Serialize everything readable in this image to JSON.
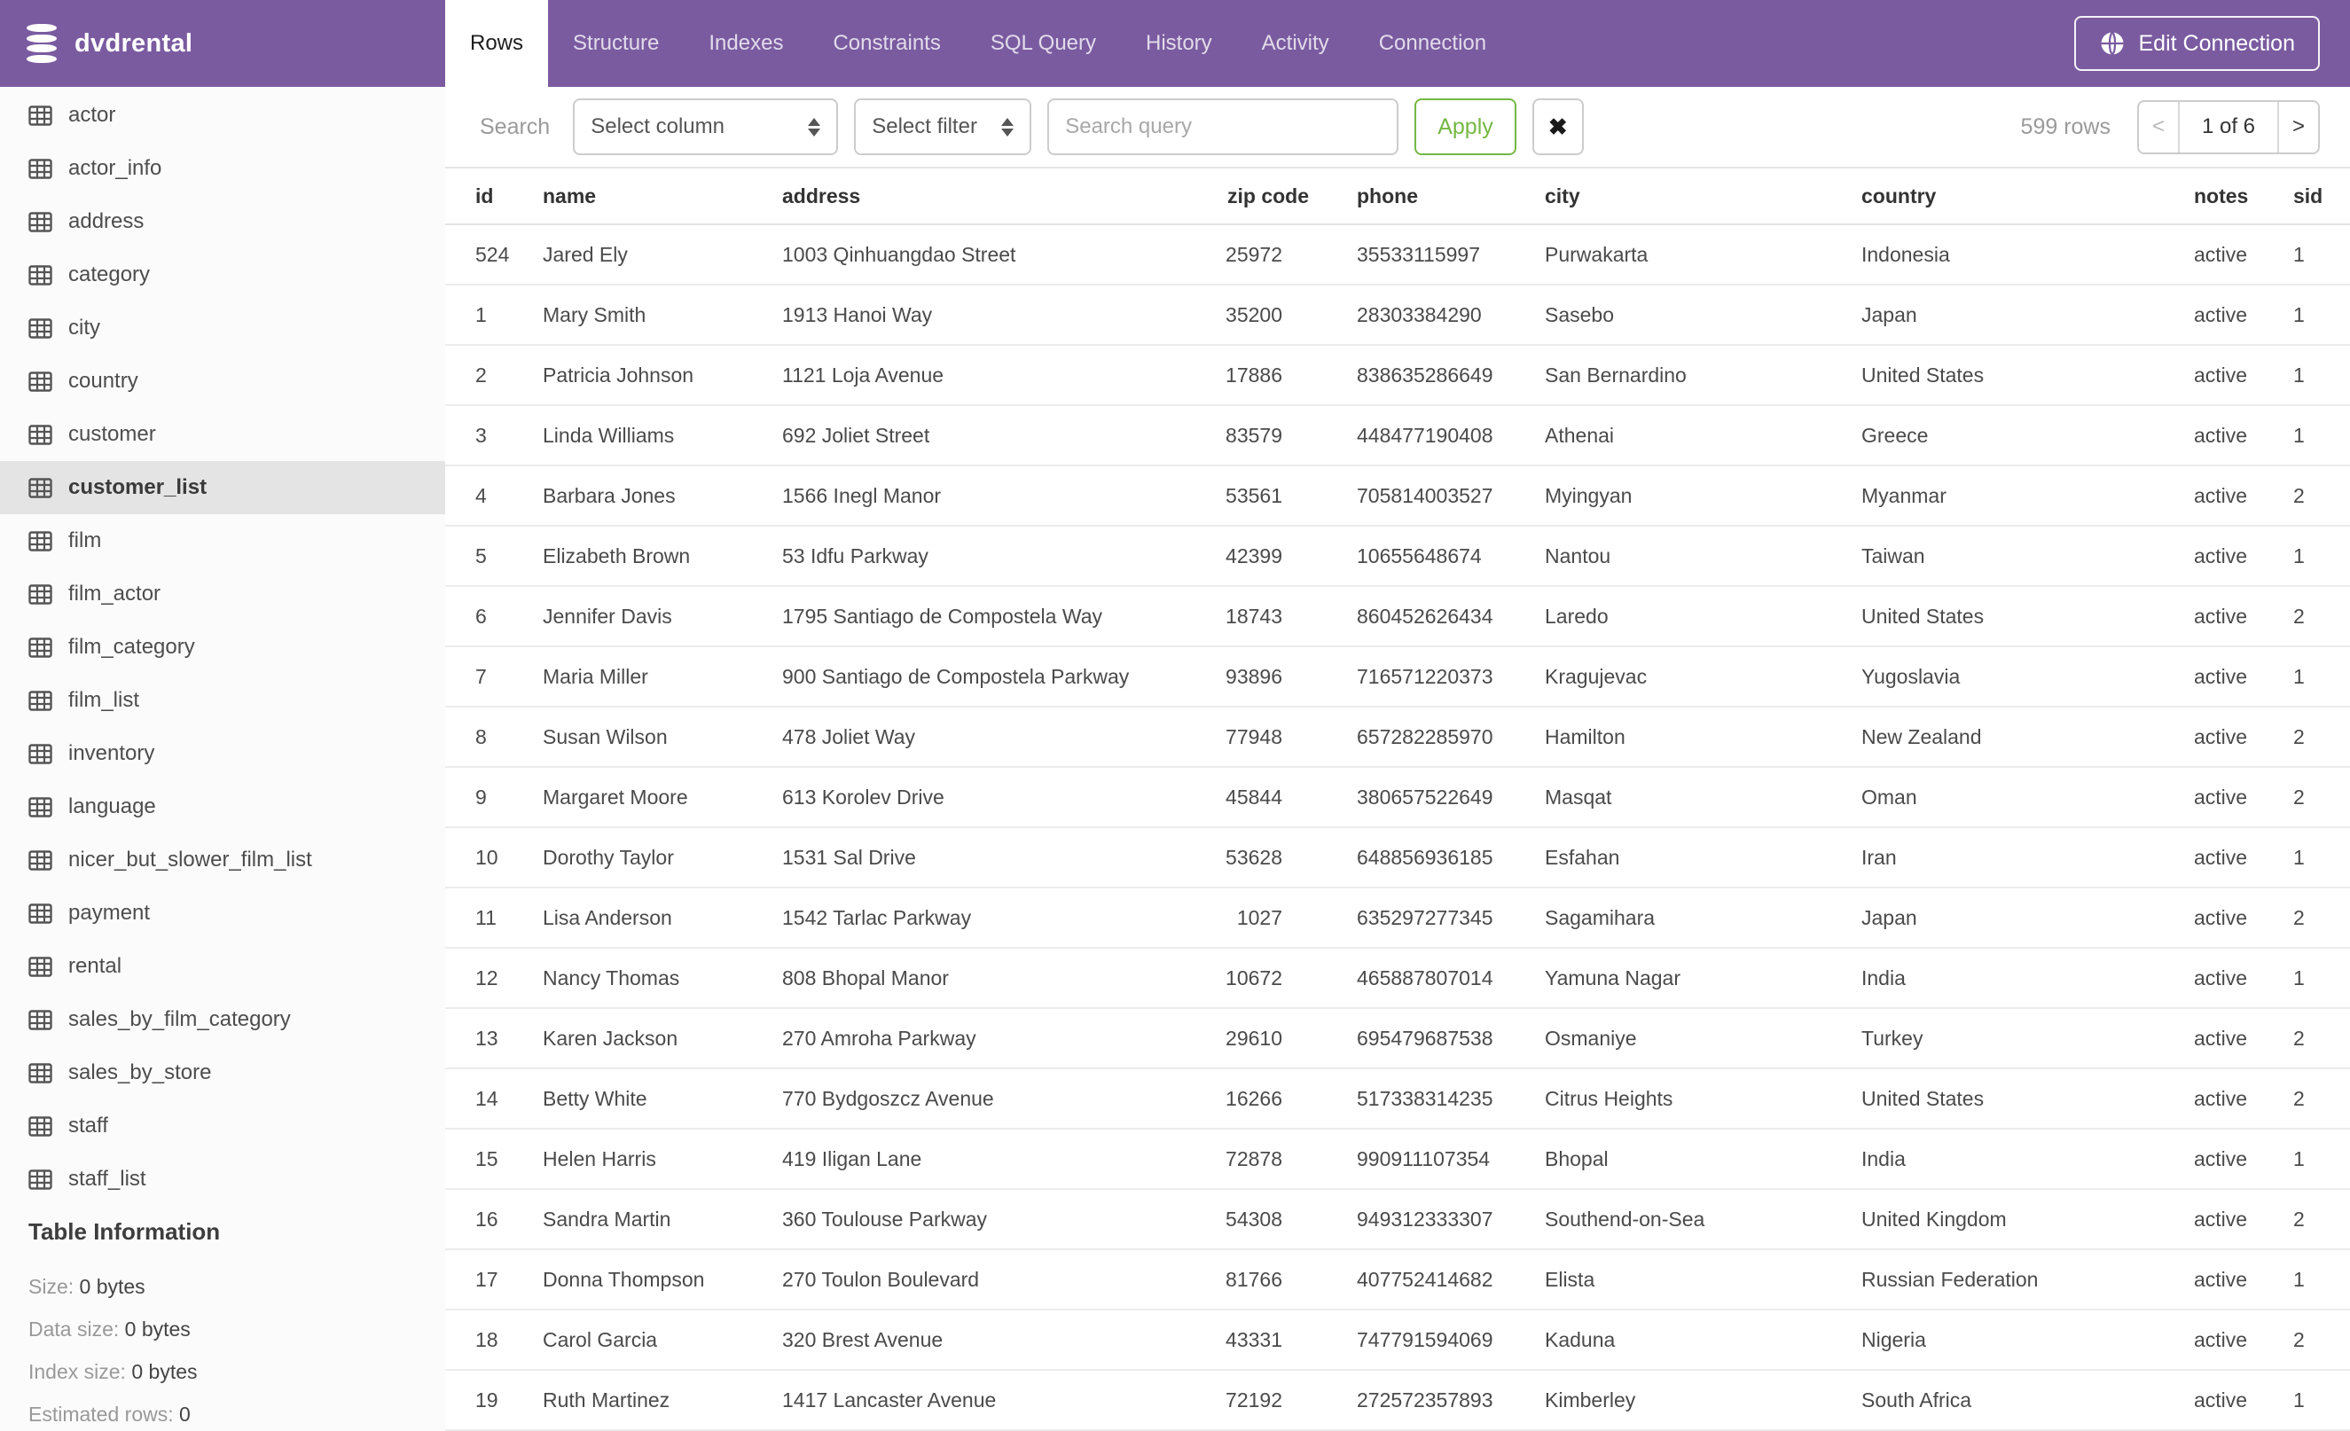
{
  "header": {
    "database_name": "dvdrental",
    "tabs": [
      {
        "label": "Rows",
        "active": true
      },
      {
        "label": "Structure",
        "active": false
      },
      {
        "label": "Indexes",
        "active": false
      },
      {
        "label": "Constraints",
        "active": false
      },
      {
        "label": "SQL Query",
        "active": false
      },
      {
        "label": "History",
        "active": false
      },
      {
        "label": "Activity",
        "active": false
      },
      {
        "label": "Connection",
        "active": false
      }
    ],
    "edit_connection_label": "Edit Connection"
  },
  "sidebar": {
    "tables": [
      "actor",
      "actor_info",
      "address",
      "category",
      "city",
      "country",
      "customer",
      "customer_list",
      "film",
      "film_actor",
      "film_category",
      "film_list",
      "inventory",
      "language",
      "nicer_but_slower_film_list",
      "payment",
      "rental",
      "sales_by_film_category",
      "sales_by_store",
      "staff",
      "staff_list"
    ],
    "selected_table": "customer_list",
    "table_information": {
      "title": "Table Information",
      "rows": [
        {
          "label": "Size: ",
          "value": "0 bytes"
        },
        {
          "label": "Data size: ",
          "value": "0 bytes"
        },
        {
          "label": "Index size: ",
          "value": "0 bytes"
        },
        {
          "label": "Estimated rows: ",
          "value": "0"
        }
      ]
    }
  },
  "toolbar": {
    "search_label": "Search",
    "select_column_placeholder": "Select column",
    "select_filter_placeholder": "Select filter",
    "query_placeholder": "Search query",
    "apply_label": "Apply",
    "clear_icon": "✖",
    "rows_count": "599 rows",
    "pagination": {
      "prev": "<",
      "current": "1 of 6",
      "next": ">"
    }
  },
  "table": {
    "columns": [
      "id",
      "name",
      "address",
      "zip code",
      "phone",
      "city",
      "country",
      "notes",
      "sid"
    ],
    "rows": [
      [
        "524",
        "Jared Ely",
        "1003 Qinhuangdao Street",
        "25972",
        "35533115997",
        "Purwakarta",
        "Indonesia",
        "active",
        "1"
      ],
      [
        "1",
        "Mary Smith",
        "1913 Hanoi Way",
        "35200",
        "28303384290",
        "Sasebo",
        "Japan",
        "active",
        "1"
      ],
      [
        "2",
        "Patricia Johnson",
        "1121 Loja Avenue",
        "17886",
        "838635286649",
        "San Bernardino",
        "United States",
        "active",
        "1"
      ],
      [
        "3",
        "Linda Williams",
        "692 Joliet Street",
        "83579",
        "448477190408",
        "Athenai",
        "Greece",
        "active",
        "1"
      ],
      [
        "4",
        "Barbara Jones",
        "1566 Inegl Manor",
        "53561",
        "705814003527",
        "Myingyan",
        "Myanmar",
        "active",
        "2"
      ],
      [
        "5",
        "Elizabeth Brown",
        "53 Idfu Parkway",
        "42399",
        "10655648674",
        "Nantou",
        "Taiwan",
        "active",
        "1"
      ],
      [
        "6",
        "Jennifer Davis",
        "1795 Santiago de Compostela Way",
        "18743",
        "860452626434",
        "Laredo",
        "United States",
        "active",
        "2"
      ],
      [
        "7",
        "Maria Miller",
        "900 Santiago de Compostela Parkway",
        "93896",
        "716571220373",
        "Kragujevac",
        "Yugoslavia",
        "active",
        "1"
      ],
      [
        "8",
        "Susan Wilson",
        "478 Joliet Way",
        "77948",
        "657282285970",
        "Hamilton",
        "New Zealand",
        "active",
        "2"
      ],
      [
        "9",
        "Margaret Moore",
        "613 Korolev Drive",
        "45844",
        "380657522649",
        "Masqat",
        "Oman",
        "active",
        "2"
      ],
      [
        "10",
        "Dorothy Taylor",
        "1531 Sal Drive",
        "53628",
        "648856936185",
        "Esfahan",
        "Iran",
        "active",
        "1"
      ],
      [
        "11",
        "Lisa Anderson",
        "1542 Tarlac Parkway",
        "1027",
        "635297277345",
        "Sagamihara",
        "Japan",
        "active",
        "2"
      ],
      [
        "12",
        "Nancy Thomas",
        "808 Bhopal Manor",
        "10672",
        "465887807014",
        "Yamuna Nagar",
        "India",
        "active",
        "1"
      ],
      [
        "13",
        "Karen Jackson",
        "270 Amroha Parkway",
        "29610",
        "695479687538",
        "Osmaniye",
        "Turkey",
        "active",
        "2"
      ],
      [
        "14",
        "Betty White",
        "770 Bydgoszcz Avenue",
        "16266",
        "517338314235",
        "Citrus Heights",
        "United States",
        "active",
        "2"
      ],
      [
        "15",
        "Helen Harris",
        "419 Iligan Lane",
        "72878",
        "990911107354",
        "Bhopal",
        "India",
        "active",
        "1"
      ],
      [
        "16",
        "Sandra Martin",
        "360 Toulouse Parkway",
        "54308",
        "949312333307",
        "Southend-on-Sea",
        "United Kingdom",
        "active",
        "2"
      ],
      [
        "17",
        "Donna Thompson",
        "270 Toulon Boulevard",
        "81766",
        "407752414682",
        "Elista",
        "Russian Federation",
        "active",
        "1"
      ],
      [
        "18",
        "Carol Garcia",
        "320 Brest Avenue",
        "43331",
        "747791594069",
        "Kaduna",
        "Nigeria",
        "active",
        "2"
      ],
      [
        "19",
        "Ruth Martinez",
        "1417 Lancaster Avenue",
        "72192",
        "272572357893",
        "Kimberley",
        "South Africa",
        "active",
        "1"
      ]
    ]
  },
  "colors": {
    "brand_purple": "#7a5ba0",
    "accent_green": "#74b843",
    "selected_item_bg": "#e4e4e4"
  }
}
